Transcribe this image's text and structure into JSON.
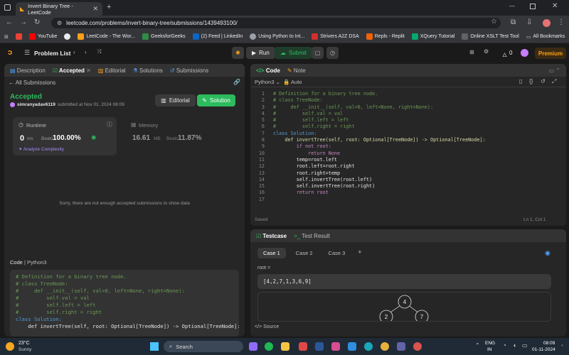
{
  "browser": {
    "tab_title": "Invert Binary Tree - LeetCode",
    "url": "leetcode.com/problems/invert-binary-tree/submissions/1439493100/",
    "bookmarks": [
      "YouTube",
      "LeetCode - The Wor...",
      "GeeksforGeeks",
      "(2) Feed | LinkedIn",
      "Using Python to Int...",
      "Strivers A2Z DSA",
      "Repls - Replit",
      "XQuery Tutorial",
      "Online XSLT Test Tool"
    ],
    "all_bookmarks": "All Bookmarks"
  },
  "nav": {
    "problem_list": "Problem List",
    "run": "Run",
    "submit": "Submit",
    "streak": "0",
    "premium": "Premium"
  },
  "left_tabs": [
    "Description",
    "Accepted",
    "Editorial",
    "Solutions",
    "Submissions"
  ],
  "submission": {
    "back": "All Submissions",
    "status": "Accepted",
    "user": "simranyadav6119",
    "submitted_at": "submitted at Nov 01, 2024 08:09",
    "editorial_btn": "Editorial",
    "solution_btn": "Solution",
    "runtime_label": "Runtime",
    "runtime_value": "0",
    "runtime_unit": "ms",
    "beats_label": "Beats",
    "runtime_beats": "100.00%",
    "analyze": "Analyze Complexity",
    "memory_label": "Memory",
    "memory_value": "16.61",
    "memory_unit": "MB",
    "memory_beats": "11.87%",
    "no_data": "Sorry, there are not enough accepted submissions to show data",
    "code_label": "Code",
    "code_lang": "Python3"
  },
  "editor": {
    "tab_code": "Code",
    "tab_note": "Note",
    "language": "Python3",
    "auto": "Auto",
    "saved": "Saved",
    "cursor": "Ln 1, Col 1",
    "lines": [
      "# Definition for a binary tree node.",
      "# class TreeNode:",
      "#     def __init__(self, val=0, left=None, right=None):",
      "#         self.val = val",
      "#         self.left = left",
      "#         self.right = right",
      "class Solution:",
      "    def invertTree(self, root: Optional[TreeNode]) -> Optional[TreeNode]:",
      "        if not root:",
      "            return None",
      "        temp=root.left",
      "        root.left=root.right",
      "        root.right=temp",
      "        self.invertTree(root.left)",
      "        self.invertTree(root.right)",
      "        return root",
      ""
    ]
  },
  "testcase": {
    "tab_testcase": "Testcase",
    "tab_result": "Test Result",
    "cases": [
      "Case 1",
      "Case 2",
      "Case 3"
    ],
    "input_label": "root =",
    "input_value": "[4,2,7,1,3,6,9]",
    "tree_nodes": [
      "4",
      "2",
      "7"
    ],
    "source": "Source"
  },
  "taskbar": {
    "temp": "23°C",
    "weather": "Sunny",
    "search": "Search",
    "lang1": "ENG",
    "lang2": "IN",
    "time": "08:09",
    "date": "01-11-2024"
  }
}
